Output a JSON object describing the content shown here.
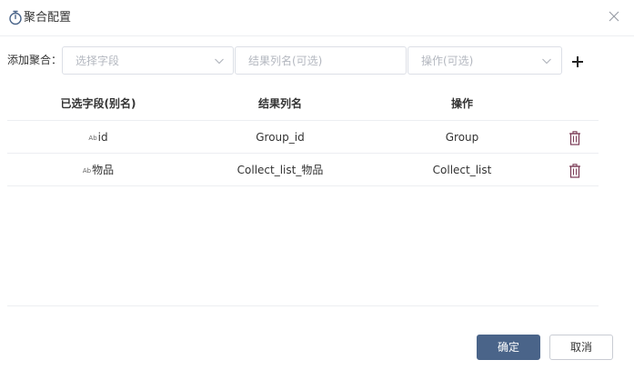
{
  "dialog": {
    "title": "聚合配置",
    "title_icon": "stopwatch-icon",
    "close_icon": "close-icon"
  },
  "toolbar": {
    "label": "添加聚合：",
    "field_placeholder": "选择字段",
    "result_placeholder": "结果列名(可选)",
    "operation_placeholder": "操作(可选)",
    "dropdown_icon": "chevron-down-icon",
    "add_icon": "plus-icon"
  },
  "table": {
    "headers": [
      "已选字段(别名)",
      "结果列名",
      "操作"
    ],
    "rows": [
      {
        "type_icon": "Ab",
        "field": "id",
        "result": "Group_id",
        "operation": "Group"
      },
      {
        "type_icon": "Ab",
        "field": "物品",
        "result": "Collect_list_物品",
        "operation": "Collect_list"
      }
    ],
    "delete_icon": "trash-icon"
  },
  "footer": {
    "ok_label": "确定",
    "cancel_label": "取消"
  },
  "colors": {
    "primary": "#4a6489",
    "border": "#dcdfe6",
    "divider": "#eceef2",
    "placeholder": "#b3b7bf",
    "delete_icon": "#7a3a55"
  }
}
